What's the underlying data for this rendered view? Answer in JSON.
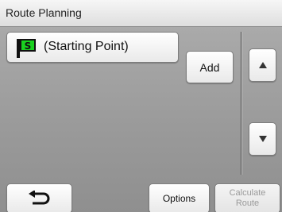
{
  "window": {
    "title": "Route Planning"
  },
  "route": {
    "starting_point_label": "(Starting Point)",
    "starting_point_flag_letter": "S",
    "flag_color": "#19d11f"
  },
  "actions": {
    "add_label": "Add",
    "options_label": "Options",
    "calculate_label": "Calculate\nRoute",
    "calculate_enabled": false
  },
  "icons": {
    "back": "back-arrow-icon",
    "scroll_up": "triangle-up-icon",
    "scroll_down": "triangle-down-icon",
    "start_flag": "start-flag-icon"
  }
}
